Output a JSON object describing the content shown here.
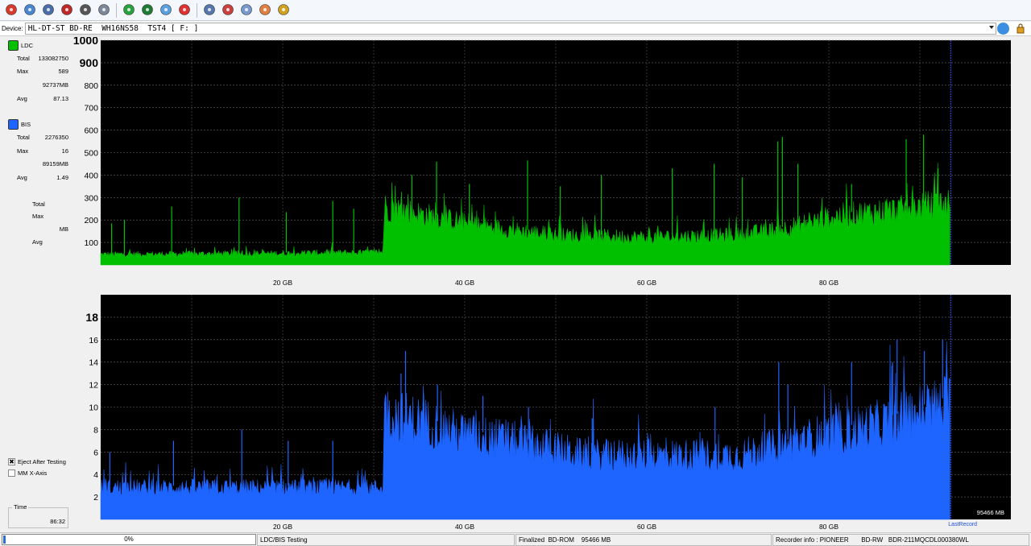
{
  "toolbar": {
    "buttons": [
      {
        "icon": "power-icon"
      },
      {
        "icon": "pin-icon"
      },
      {
        "icon": "drive-info-icon"
      },
      {
        "icon": "erase-disc-icon"
      },
      {
        "icon": "disc-tool-icon"
      },
      {
        "icon": "copy-icon"
      },
      {
        "icon": "refresh-icon"
      },
      {
        "icon": "globe-icon"
      },
      {
        "icon": "disc-check-icon"
      },
      {
        "icon": "stop-icon"
      },
      {
        "icon": "scan-disc-icon"
      },
      {
        "icon": "burn-icon"
      },
      {
        "icon": "transfer-icon"
      },
      {
        "icon": "settings-disc-icon"
      },
      {
        "icon": "folder-icon"
      }
    ]
  },
  "device": {
    "label": "Device:",
    "value": "HL-DT-ST BD-RE  WH16NS58  TST4 [ F: ]"
  },
  "sidebar": {
    "ldc": {
      "name": "LDC",
      "color": "#00c000",
      "total_label": "Total",
      "total": "133082750",
      "max_label": "Max",
      "max": "589",
      "max_pos": "92737MB",
      "avg_label": "Avg",
      "avg": "87.13"
    },
    "bis": {
      "name": "BIS",
      "color": "#1e64ff",
      "total_label": "Total",
      "total": "2276350",
      "max_label": "Max",
      "max": "16",
      "max_pos": "89159MB",
      "avg_label": "Avg",
      "avg": "1.49"
    },
    "third": {
      "total_label": "Total",
      "max_label": "Max",
      "unit": "MB",
      "avg_label": "Avg"
    },
    "eject_after_testing": {
      "label": "Eject After Testing",
      "checked": true
    },
    "mm_x_axis": {
      "label": "MM X-Axis",
      "checked": false
    },
    "time": {
      "label": "Time",
      "value": "86:32"
    }
  },
  "chart_data": [
    {
      "type": "area",
      "series": [
        {
          "name": "LDC",
          "color": "#00c000"
        }
      ],
      "xlim": [
        0,
        100
      ],
      "ylim": [
        0,
        1000
      ],
      "y_ticks": [
        100,
        200,
        300,
        400,
        500,
        600,
        700,
        800,
        900,
        1000
      ],
      "y_tick_labels": [
        "100",
        "200",
        "300",
        "400",
        "500",
        "600",
        "700",
        "800",
        "900",
        "1000"
      ],
      "x_ticks": [
        20,
        40,
        60,
        80
      ],
      "x_tick_labels": [
        "20 GB",
        "40 GB",
        "60 GB",
        "80 GB"
      ],
      "data_end": 93.3,
      "profile": [
        {
          "x": 0,
          "y": 50
        },
        {
          "x": 20,
          "y": 55
        },
        {
          "x": 31,
          "y": 60
        },
        {
          "x": 31.2,
          "y": 270
        },
        {
          "x": 36,
          "y": 230
        },
        {
          "x": 42,
          "y": 180
        },
        {
          "x": 50,
          "y": 140
        },
        {
          "x": 60,
          "y": 130
        },
        {
          "x": 70,
          "y": 140
        },
        {
          "x": 75,
          "y": 170
        },
        {
          "x": 81,
          "y": 230
        },
        {
          "x": 88,
          "y": 260
        },
        {
          "x": 93.3,
          "y": 290
        }
      ],
      "spikes": [
        {
          "x": 1.2,
          "y": 185
        },
        {
          "x": 2.6,
          "y": 200
        },
        {
          "x": 7.8,
          "y": 260
        },
        {
          "x": 15.2,
          "y": 300
        },
        {
          "x": 20.4,
          "y": 235
        },
        {
          "x": 25.5,
          "y": 285
        },
        {
          "x": 27.8,
          "y": 250
        },
        {
          "x": 34.2,
          "y": 400
        },
        {
          "x": 36.9,
          "y": 460
        },
        {
          "x": 40.5,
          "y": 360
        },
        {
          "x": 46.9,
          "y": 465
        },
        {
          "x": 50.5,
          "y": 350
        },
        {
          "x": 55.0,
          "y": 400
        },
        {
          "x": 62.8,
          "y": 430
        },
        {
          "x": 67.4,
          "y": 450
        },
        {
          "x": 70.5,
          "y": 390
        },
        {
          "x": 74.4,
          "y": 550
        },
        {
          "x": 74.9,
          "y": 570
        },
        {
          "x": 76.6,
          "y": 450
        },
        {
          "x": 82.5,
          "y": 360
        },
        {
          "x": 88.5,
          "y": 560
        },
        {
          "x": 90.4,
          "y": 580
        },
        {
          "x": 92.0,
          "y": 430
        }
      ]
    },
    {
      "type": "area",
      "series": [
        {
          "name": "BIS",
          "color": "#1e64ff"
        }
      ],
      "xlim": [
        0,
        100
      ],
      "ylim": [
        0,
        20
      ],
      "y_ticks": [
        2,
        4,
        6,
        8,
        10,
        12,
        14,
        16,
        18
      ],
      "y_tick_labels": [
        "2",
        "4",
        "6",
        "8",
        "10",
        "12",
        "14",
        "16",
        "18"
      ],
      "x_ticks": [
        20,
        40,
        60,
        80
      ],
      "x_tick_labels": [
        "20 GB",
        "40 GB",
        "60 GB",
        "80 GB"
      ],
      "data_end": 93.3,
      "profile": [
        {
          "x": 0,
          "y": 3
        },
        {
          "x": 31,
          "y": 3
        },
        {
          "x": 31.2,
          "y": 10
        },
        {
          "x": 36,
          "y": 9
        },
        {
          "x": 40,
          "y": 8
        },
        {
          "x": 48,
          "y": 7
        },
        {
          "x": 53,
          "y": 6
        },
        {
          "x": 70,
          "y": 6
        },
        {
          "x": 75,
          "y": 7
        },
        {
          "x": 80,
          "y": 8
        },
        {
          "x": 86,
          "y": 9
        },
        {
          "x": 93.3,
          "y": 11
        }
      ],
      "spikes": [
        {
          "x": 1.0,
          "y": 6
        },
        {
          "x": 8.0,
          "y": 7
        },
        {
          "x": 15.5,
          "y": 8
        },
        {
          "x": 20.6,
          "y": 7
        },
        {
          "x": 25.5,
          "y": 7
        },
        {
          "x": 33.0,
          "y": 13
        },
        {
          "x": 33.5,
          "y": 15
        },
        {
          "x": 37.0,
          "y": 12
        },
        {
          "x": 42.0,
          "y": 11
        },
        {
          "x": 47.0,
          "y": 10
        },
        {
          "x": 54.0,
          "y": 9
        },
        {
          "x": 67.5,
          "y": 10
        },
        {
          "x": 74.5,
          "y": 14
        },
        {
          "x": 75.5,
          "y": 12
        },
        {
          "x": 82.5,
          "y": 14
        },
        {
          "x": 87.0,
          "y": 14
        },
        {
          "x": 87.5,
          "y": 16
        },
        {
          "x": 90.5,
          "y": 15
        },
        {
          "x": 92.5,
          "y": 16
        }
      ],
      "annotations": {
        "size": "95466 MB",
        "last_record": "LastRecord"
      }
    }
  ],
  "status": {
    "progress": 0.01,
    "progress_text": "0%",
    "mode": "LDC/BIS Testing",
    "disc": "Finalized  BD-ROM    95466 MB",
    "recorder": "Recorder info : PIONEER       BD-RW   BDR-211MQCDL000380WL"
  }
}
